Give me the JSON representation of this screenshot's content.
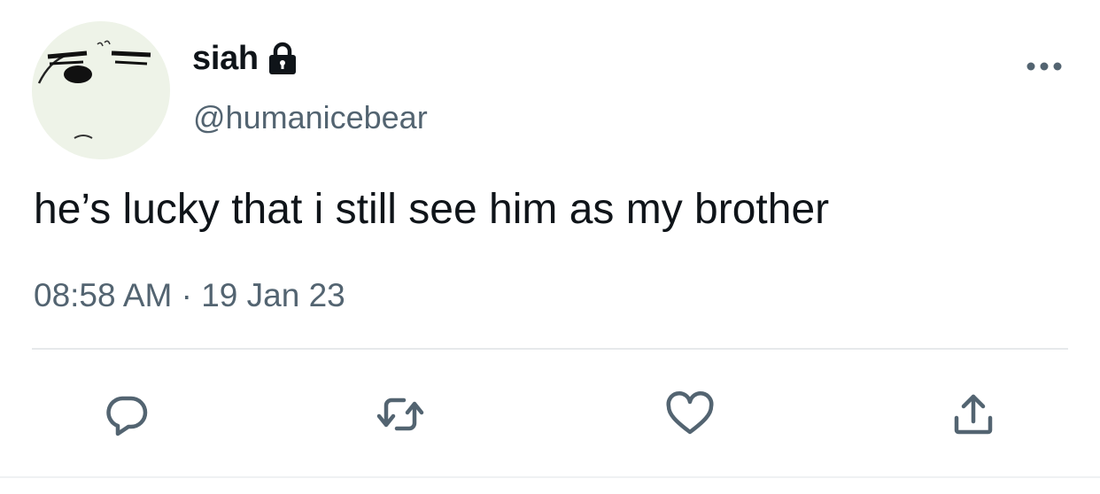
{
  "author": {
    "display_name": "siah",
    "handle": "@humanicebear",
    "protected_icon": "lock-icon",
    "avatar": "avatar-icon"
  },
  "tweet": {
    "text": "he’s lucky that i still see him as my brother",
    "time": "08:58 AM",
    "separator": "·",
    "date": "19 Jan 23"
  },
  "actions": {
    "more": "more-options-icon",
    "reply": "reply-icon",
    "retweet": "retweet-icon",
    "like": "like-icon",
    "share": "share-icon"
  },
  "colors": {
    "text": "#0f1419",
    "secondary": "#536471",
    "divider": "#e6e9eb",
    "avatar_bg": "#eef3e8"
  }
}
